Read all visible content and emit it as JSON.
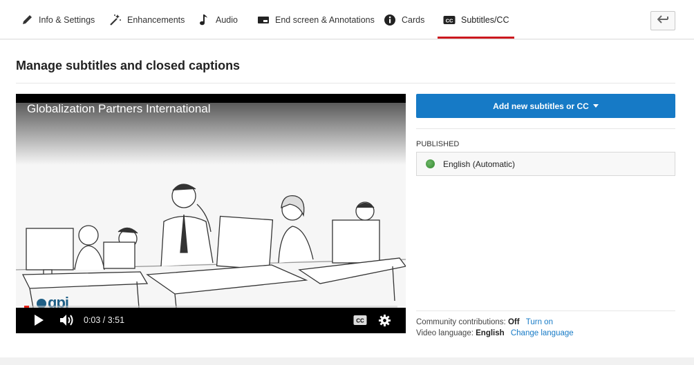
{
  "tabs": [
    {
      "label": "Info & Settings",
      "icon": "pencil-icon"
    },
    {
      "label": "Enhancements",
      "icon": "magic-wand-icon"
    },
    {
      "label": "Audio",
      "icon": "music-note-icon"
    },
    {
      "label": "End screen & Annotations",
      "icon": "end-screen-icon"
    },
    {
      "label": "Cards",
      "icon": "info-icon"
    },
    {
      "label": "Subtitles/CC",
      "icon": "cc-icon",
      "active": true
    }
  ],
  "back_button": {
    "icon": "back-arrow-icon"
  },
  "page_title": "Manage subtitles and closed captions",
  "video": {
    "title": "Globalization Partners International",
    "logo_text": "gpi",
    "current_time": "0:03",
    "duration": "3:51",
    "time_display": "0:03 / 3:51",
    "progress_fraction": 0.013,
    "icons": [
      "play-icon",
      "volume-icon",
      "cc-icon",
      "settings-gear-icon"
    ]
  },
  "add_button": {
    "label": "Add new subtitles or CC"
  },
  "published": {
    "heading": "PUBLISHED",
    "tracks": [
      {
        "label": "English (Automatic)",
        "status_color": "#3d9a38"
      }
    ]
  },
  "footer": {
    "community_label": "Community contributions:",
    "community_value": "Off",
    "community_link": "Turn on",
    "language_label": "Video language:",
    "language_value": "English",
    "language_link": "Change language"
  },
  "colors": {
    "accent_blue": "#167ac6",
    "active_tab_red": "#cc181e"
  }
}
